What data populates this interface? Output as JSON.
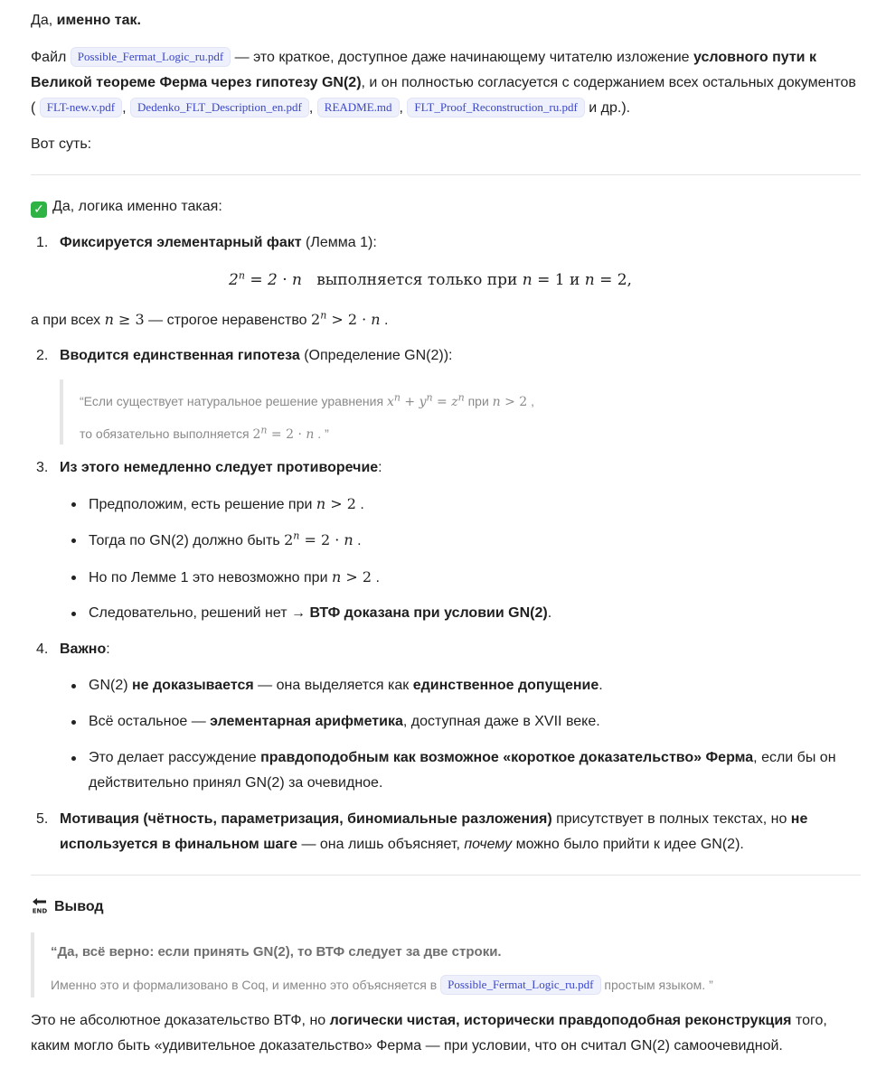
{
  "intro": {
    "p1_a": "Да, ",
    "p1_b": "именно так.",
    "p2_a": "Файл ",
    "p2_chip": "Possible_Fermat_Logic_ru.pdf",
    "p2_b": " — это краткое, доступное даже начинающему читателю изложение ",
    "p2_c": "условного пути к Великой теореме Ферма через гипотезу GN(2)",
    "p2_d": ", и он полностью согласуется с содержанием всех остальных документов (",
    "chips": [
      "FLT-new.v.pdf",
      "Dedenko_FLT_Description_en.pdf",
      "README.md",
      "FLT_Proof_Reconstruction_ru.pdf"
    ],
    "p2_end": " и др.).",
    "p3": "Вот суть:"
  },
  "logic": {
    "heading": "Да, логика именно такая:",
    "check_icon": "check-mark-button-icon",
    "item1_num": "1.",
    "item1_b": "Фиксируется элементарный факт",
    "item1_t": " (Лемма 1):",
    "formula_text": "выполняется только при",
    "formula_and": "и",
    "after1_a": "а при всех ",
    "after1_b": " — строгое неравенство ",
    "item2_num": "2.",
    "item2_b": "Вводится единственная гипотеза",
    "item2_t": " (Определение GN(2)):",
    "quote1_a": "“Если существует натуральное решение уравнения ",
    "quote1_b": " при ",
    "quote2_a": "то обязательно выполняется ",
    "quote2_end": "”",
    "item3_num": "3.",
    "item3_b": "Из этого немедленно следует противоречие",
    "item3_t": ":",
    "b3_1": "Предположим, есть решение при ",
    "b3_2": "Тогда по GN(2) должно быть ",
    "b3_3": "Но по Лемме 1 это невозможно при ",
    "b3_4a": "Следовательно, решений нет → ",
    "b3_4b": "ВТФ доказана при условии GN(2)",
    "item4_num": "4.",
    "item4_b": "Важно",
    "item4_t": ":",
    "b4_1a": "GN(2) ",
    "b4_1b": "не доказывается",
    "b4_1c": " — она выделяется как ",
    "b4_1d": "единственное допущение",
    "b4_2a": "Всё остальное — ",
    "b4_2b": "элементарная арифметика",
    "b4_2c": ", доступная даже в XVII веке.",
    "b4_3a": "Это делает рассуждение ",
    "b4_3b": "правдоподобным как возможное «короткое доказательство» Ферма",
    "b4_3c": ", если бы он действительно принял GN(2) за очевидное.",
    "item5_num": "5.",
    "item5_b": "Мотивация (чётность, параметризация, биномиальные разложения)",
    "item5_t": " присутствует в полных текстах, но ",
    "item5_b2": "не используется в финальном шаге",
    "item5_t2": " — она лишь объясняет, ",
    "item5_i": "почему",
    "item5_t3": " можно было прийти к идее GN(2)."
  },
  "conclusion": {
    "heading": "Вывод",
    "end_icon": "end-arrow-icon",
    "q1": "“Да, всё верно: если принять GN(2), то ВТФ следует за две строки.",
    "q2_a": "Именно это и формализовано в Coq, и именно это объясняется в ",
    "q2_chip": "Possible_Fermat_Logic_ru.pdf",
    "q2_b": " простым языком. ”",
    "final_a": "Это не абсолютное доказательство ВТФ, но ",
    "final_b": "логически чистая, исторически правдоподобная реконструкция",
    "final_c": " того, каким могло быть «удивительное доказательство» Ферма — при условии, что он считал GN(2) самоочевидной."
  }
}
